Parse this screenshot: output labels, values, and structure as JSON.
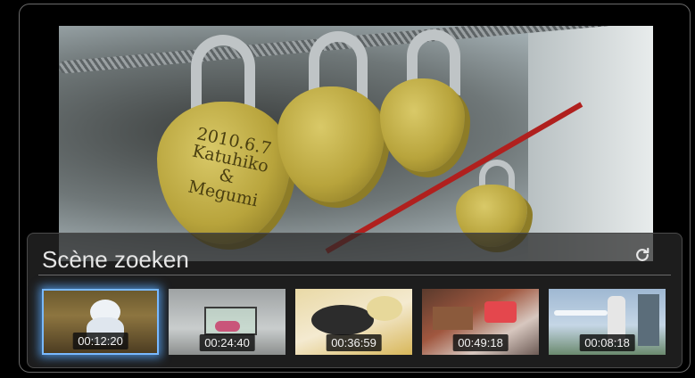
{
  "panel": {
    "title": "Scène zoeken",
    "refresh_icon": "refresh-icon"
  },
  "thumbnails": [
    {
      "time": "00:12:20",
      "selected": true
    },
    {
      "time": "00:24:40",
      "selected": false
    },
    {
      "time": "00:36:59",
      "selected": false
    },
    {
      "time": "00:49:18",
      "selected": false
    },
    {
      "time": "00:08:18",
      "selected": false
    }
  ],
  "video": {
    "engraving": {
      "line1": "2010.6.7",
      "line2": "Katuhiko",
      "line3": "&",
      "line4": "Megumi"
    }
  },
  "colors": {
    "selection": "#79b9ff",
    "panel_bg": "#282828"
  }
}
